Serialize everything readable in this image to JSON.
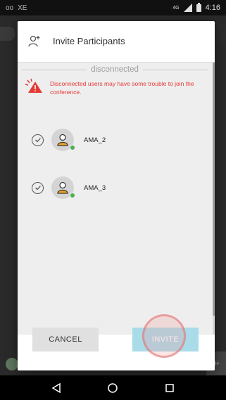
{
  "status_bar": {
    "left_text": "XE",
    "network": "4G",
    "time": "4:16"
  },
  "dialog": {
    "title": "Invite Participants",
    "header_icon": "add-person-icon",
    "section_title": "disconnected",
    "warning_text": "Disconnected users may have some trouble to join the conference.",
    "warning_icon": "warning-triangle-icon",
    "participants": [
      {
        "name": "AMA_2",
        "checked": true,
        "presence": "online"
      },
      {
        "name": "AMA_3",
        "checked": true,
        "presence": "online"
      }
    ],
    "cancel_label": "CANCEL",
    "invite_label": "INVITE"
  },
  "background": {
    "bottom_right_hint": "0+"
  },
  "colors": {
    "warning": "#e53935",
    "presence_online": "#4caf50",
    "invite_button": "#a9dbe9",
    "cancel_button": "#e0e0e0"
  }
}
